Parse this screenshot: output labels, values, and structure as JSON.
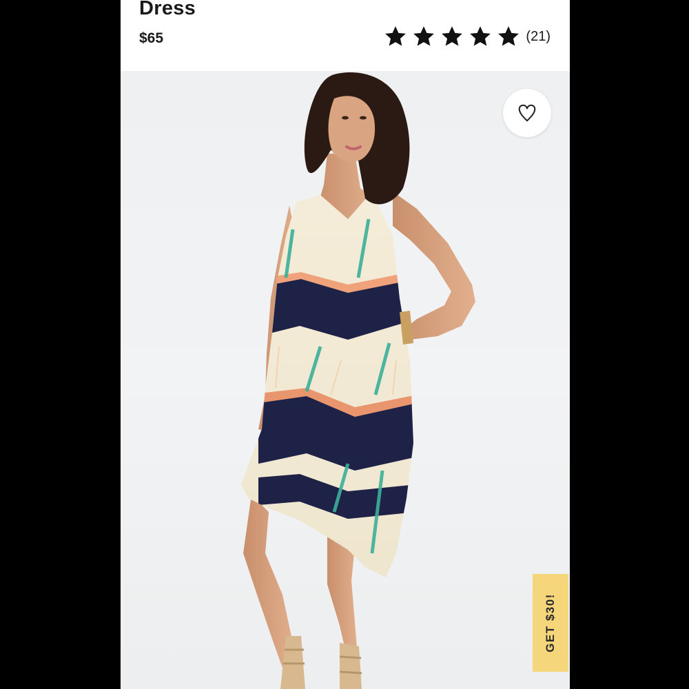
{
  "product": {
    "title": "Dress",
    "price": "$65",
    "rating": {
      "value": 5,
      "max": 5,
      "count_label": "(21)"
    },
    "image_alt": "Model wearing draped geometric print halter dress"
  },
  "promo": {
    "label": "GET $30!"
  },
  "colors": {
    "accent_yellow": "#f6d67a",
    "text": "#1a1a1a",
    "background": "#ffffff",
    "frame": "#000000"
  },
  "icons": {
    "favorite": "heart-outline-icon",
    "star": "star-filled-icon"
  }
}
